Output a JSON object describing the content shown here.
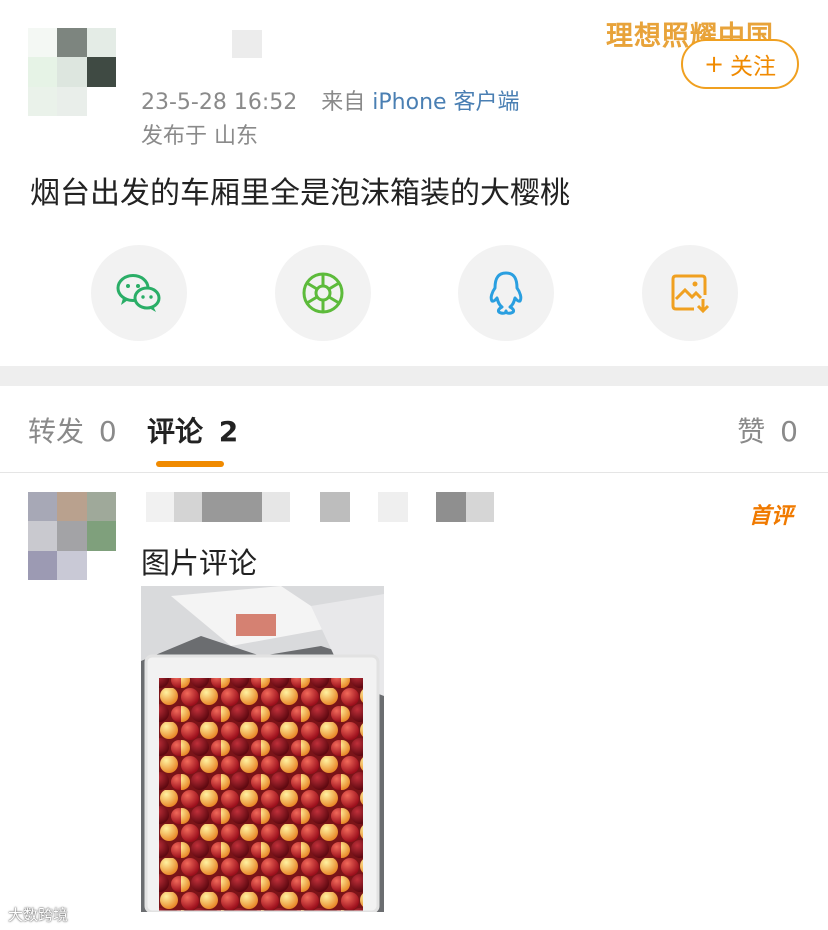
{
  "post": {
    "timestamp": "23-5-28 16:52",
    "source_prefix": "来自",
    "source": "iPhone 客户端",
    "location": "发布于 山东",
    "badge_text": "理想照耀中国",
    "follow": {
      "plus": "+",
      "label": "关注"
    },
    "text": "烟台出发的车厢里全是泡沫箱装的大樱桃"
  },
  "share": [
    {
      "icon": "wechat-icon",
      "color": "#2aae67"
    },
    {
      "icon": "moments-icon",
      "color": "#5dbb3b"
    },
    {
      "icon": "qq-icon",
      "color": "#2a9fe0"
    },
    {
      "icon": "save-image-icon",
      "color": "#f0a020"
    }
  ],
  "tabs": {
    "repost": {
      "label": "转发",
      "count": "0"
    },
    "comment": {
      "label": "评论",
      "count": "2"
    },
    "like": {
      "label": "赞",
      "count": "0"
    }
  },
  "comment": {
    "first_badge": "首评",
    "text": "图片评论"
  },
  "watermark": "大数跨境",
  "colors": {
    "accent": "#f08a00",
    "link": "#4a7fb3",
    "muted": "#8a8a8a"
  }
}
